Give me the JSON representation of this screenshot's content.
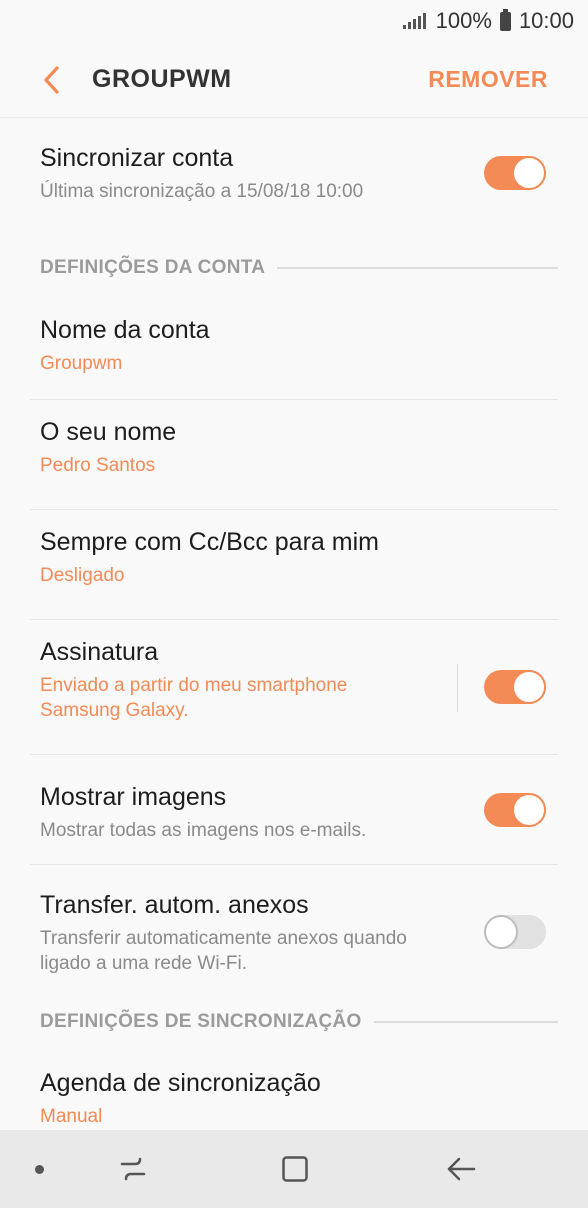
{
  "status": {
    "battery": "100%",
    "time": "10:00"
  },
  "appbar": {
    "title": "GROUPWM",
    "remove_label": "REMOVER"
  },
  "sync": {
    "title": "Sincronizar conta",
    "subtitle": "Última sincronização a 15/08/18  10:00",
    "enabled": true
  },
  "section_account": {
    "label": "DEFINIÇÕES DA CONTA"
  },
  "account_name": {
    "title": "Nome da conta",
    "value": "Groupwm"
  },
  "your_name": {
    "title": "O seu nome",
    "value": "Pedro Santos"
  },
  "cc_bcc": {
    "title": "Sempre com Cc/Bcc para mim",
    "value": "Desligado"
  },
  "signature": {
    "title": "Assinatura",
    "value_line1": "Enviado a partir do meu smartphone",
    "value_line2": "Samsung Galaxy.",
    "enabled": true
  },
  "show_images": {
    "title": "Mostrar imagens",
    "subtitle": "Mostrar todas as imagens nos e-mails.",
    "enabled": true
  },
  "auto_download": {
    "title": "Transfer. autom. anexos",
    "subtitle_line1": "Transferir automaticamente anexos quando",
    "subtitle_line2": "ligado a uma rede Wi-Fi.",
    "enabled": false
  },
  "section_sync": {
    "label": "DEFINIÇÕES DE SINCRONIZAÇÃO"
  },
  "sync_schedule": {
    "title": "Agenda de sincronização",
    "value": "Manual"
  },
  "colors": {
    "accent": "#f48a55",
    "background": "#f9f9f9",
    "navbar": "#e9e9e9"
  },
  "navbar": {
    "icons": [
      "dot-icon",
      "recents-icon",
      "home-icon",
      "back-arrow-icon"
    ]
  }
}
